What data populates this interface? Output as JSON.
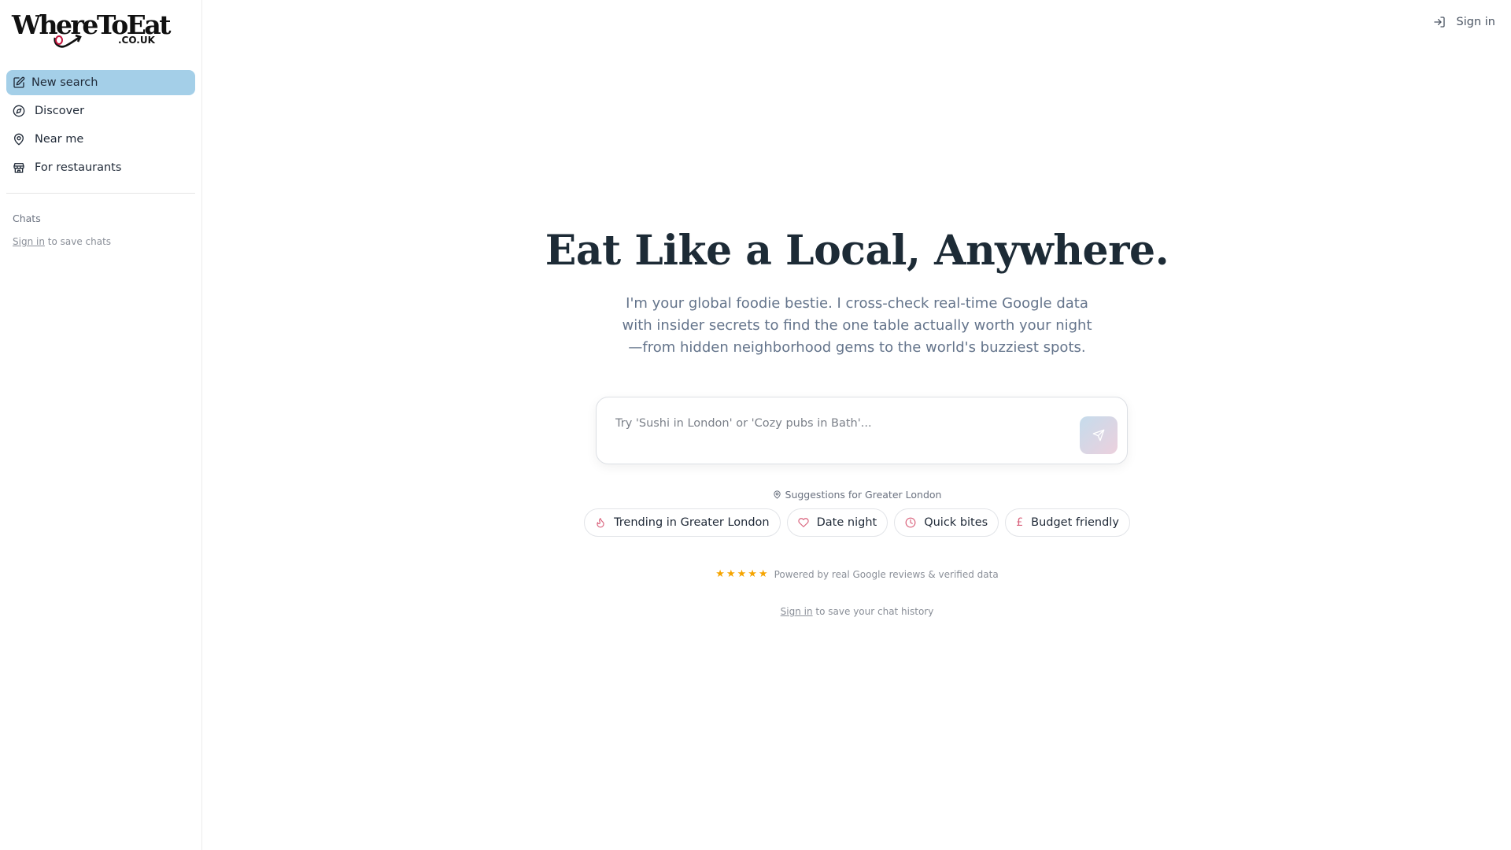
{
  "brand": {
    "logo_text": "WhereToEat",
    "logo_domain": ".CO.UK"
  },
  "sidebar": {
    "items": [
      {
        "label": "New search",
        "icon": "edit-icon",
        "active": true
      },
      {
        "label": "Discover",
        "icon": "compass-icon",
        "active": false
      },
      {
        "label": "Near me",
        "icon": "map-pin-icon",
        "active": false
      },
      {
        "label": "For restaurants",
        "icon": "store-icon",
        "active": false
      }
    ],
    "chats_title": "Chats",
    "chats_signin_link": "Sign in",
    "chats_signin_suffix": "to save chats"
  },
  "header": {
    "signin_label": "Sign in"
  },
  "hero": {
    "headline": "Eat Like a Local, Anywhere.",
    "subtitle": "I'm your global foodie bestie. I cross-check real-time Google data with insider secrets to find the one table actually worth your night—from hidden neighborhood gems to the world's buzziest spots."
  },
  "search": {
    "placeholder": "Try 'Sushi in London' or 'Cozy pubs in Bath'...",
    "value": ""
  },
  "suggestions": {
    "label": "Suggestions for Greater London",
    "chips": [
      {
        "label": "Trending in Greater London",
        "icon": "flame-icon"
      },
      {
        "label": "Date night",
        "icon": "heart-icon"
      },
      {
        "label": "Quick bites",
        "icon": "clock-icon"
      },
      {
        "label": "Budget friendly",
        "icon": "pound-icon",
        "glyph": "£"
      }
    ]
  },
  "trust": {
    "star_count": 5,
    "star_color": "#f5a400",
    "text": "Powered by real Google reviews & verified data"
  },
  "footer_note": {
    "link": "Sign in",
    "suffix": "to save your chat history"
  },
  "colors": {
    "active_nav": "#a4cfe8",
    "accent": "#d9627c",
    "headline": "#1d2b36"
  }
}
